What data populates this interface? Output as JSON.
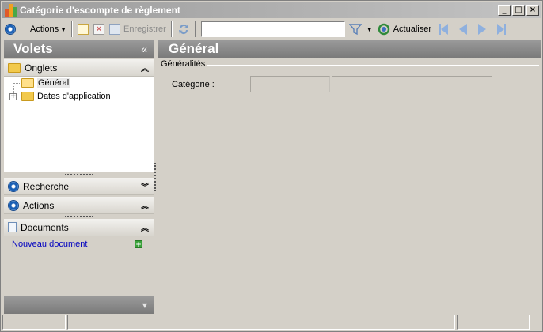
{
  "window": {
    "title": "Catégorie d'escompte de règlement",
    "controls": {
      "minimize": "_",
      "maximize": "□",
      "close": "×"
    }
  },
  "toolbar": {
    "actions_label": "Actions",
    "save_label": "Enregistrer",
    "search_value": "",
    "refresh_label": "Actualiser"
  },
  "left_panel": {
    "title": "Volets",
    "collapse_glyph": "«",
    "sections": {
      "onglets": "Onglets",
      "recherche": "Recherche",
      "actions": "Actions",
      "documents": "Documents"
    },
    "tree": {
      "general": "Général",
      "dates": "Dates d'application"
    },
    "new_document_link": "Nouveau document"
  },
  "content": {
    "title": "Général",
    "group_title": "Généralités",
    "category_label": "Catégorie :",
    "category_code": "",
    "category_description": ""
  },
  "colors": {
    "panel_header": "#8a8a8a",
    "window_bg": "#d4d0c8",
    "link": "#0000c0",
    "accent_blue": "#1a5fb4"
  }
}
